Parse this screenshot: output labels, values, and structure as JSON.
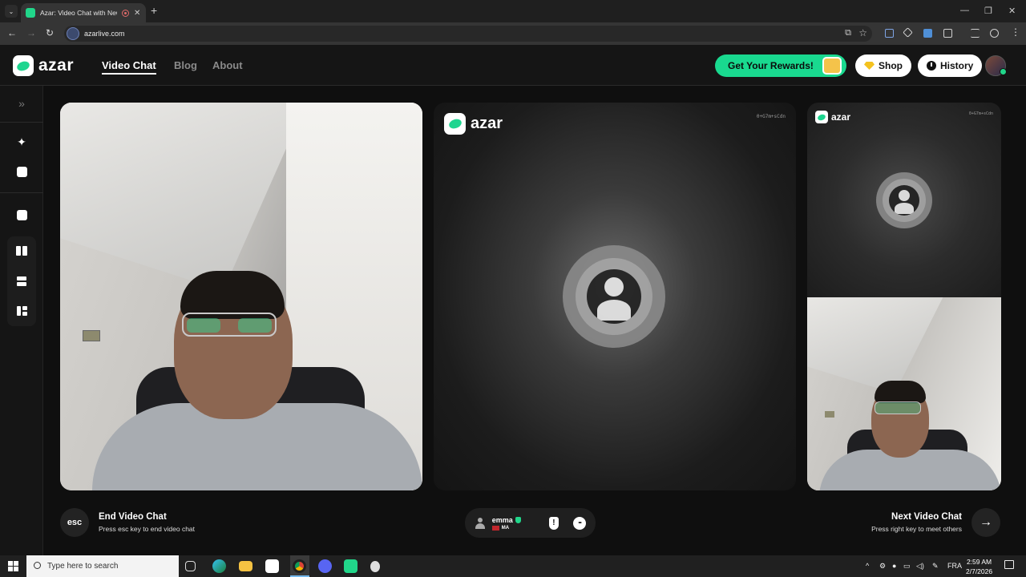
{
  "browser": {
    "tab_title": "Azar: Video Chat with New",
    "tab_close": "✕",
    "new_tab": "+",
    "url": "azarlive.com",
    "window_controls": {
      "minimize": "—",
      "restore": "❐",
      "close": "✕"
    }
  },
  "header": {
    "logo": "azar",
    "nav": [
      {
        "label": "Video Chat",
        "active": true
      },
      {
        "label": "Blog",
        "active": false
      },
      {
        "label": "About",
        "active": false
      }
    ],
    "rewards_label": "Get Your Rewards!",
    "shop_label": "Shop",
    "history_label": "History"
  },
  "sidebar": {
    "icons": [
      "expand-icon",
      "magic-wand-icon",
      "face-icon",
      "dice-icon",
      "layout-split-icon",
      "layout-stack-icon",
      "layout-grid-icon"
    ]
  },
  "remote": {
    "watermark": "azar",
    "code": "0+G7m+sCdn"
  },
  "preview": {
    "watermark": "azar",
    "code": "0+G7m+sCdn"
  },
  "controls": {
    "esc_key": "esc",
    "end_title": "End Video Chat",
    "end_sub": "Press esc key to end video chat",
    "next_title": "Next Video Chat",
    "next_sub": "Press right key to meet others",
    "next_arrow": "→",
    "partner_name": "emma",
    "partner_country": "MA",
    "report_glyph": "!",
    "chat_glyph": "•••"
  },
  "taskbar": {
    "search_placeholder": "Type here to search",
    "language": "FRA",
    "time": "2:59 AM",
    "date": "2/7/2026"
  },
  "colors": {
    "accent": "#19d98f",
    "background": "#0f0f0f"
  }
}
